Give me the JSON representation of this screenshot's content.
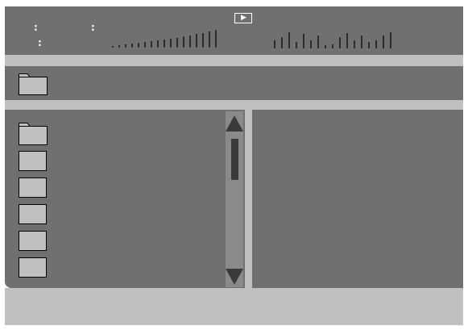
{
  "status": {
    "colon_1": ":",
    "colon_2": ":",
    "colon_3": ":",
    "play_glyph": "▶"
  },
  "icons": {
    "play": "play-icon",
    "folder": "folder-icon",
    "file": "file-icon",
    "scroll_up": "scroll-up-arrow-icon",
    "scroll_down": "scroll-down-arrow-icon"
  },
  "list": {
    "folder_count": 1,
    "file_count": 5
  },
  "colors": {
    "panel": "#707070",
    "strip": "#c0c0c0",
    "file_box": "#c0c0c0",
    "scrollbar_track": "#8a8a8a",
    "scrollbar_thumb": "#3a3a3a"
  }
}
